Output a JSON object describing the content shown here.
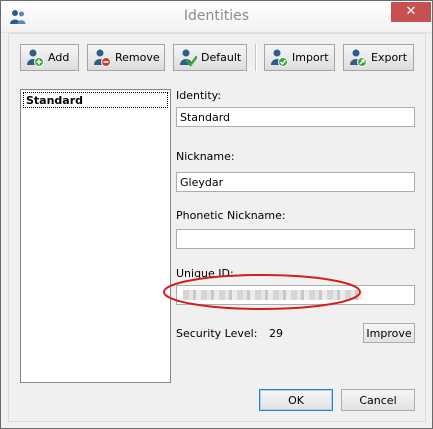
{
  "window": {
    "title": "Identities",
    "close_glyph": "✕"
  },
  "toolbar": {
    "add_label": "Add",
    "remove_label": "Remove",
    "default_label": "Default",
    "import_label": "Import",
    "export_label": "Export"
  },
  "identity_list": {
    "items": [
      {
        "label": "Standard",
        "selected": true
      }
    ]
  },
  "form": {
    "identity_label": "Identity:",
    "identity_value": "Standard",
    "nickname_label": "Nickname:",
    "nickname_value": "Gleydar",
    "phonetic_label": "Phonetic Nickname:",
    "phonetic_value": "",
    "unique_id_label": "Unique ID:",
    "unique_id_value": "",
    "security_level_label": "Security Level:",
    "security_level_value": "29",
    "improve_label": "Improve"
  },
  "footer": {
    "ok_label": "OK",
    "cancel_label": "Cancel"
  },
  "colors": {
    "close_button": "#c75050",
    "highlight_ellipse": "#d21f1f",
    "icon_blue": "#2f5d8a",
    "icon_green": "#3aa33a",
    "icon_red": "#d23a2a"
  },
  "icons": {
    "app": "users-icon",
    "add": "user-add-icon",
    "remove": "user-remove-icon",
    "default": "user-check-icon",
    "import": "user-import-icon",
    "export": "user-export-icon"
  }
}
